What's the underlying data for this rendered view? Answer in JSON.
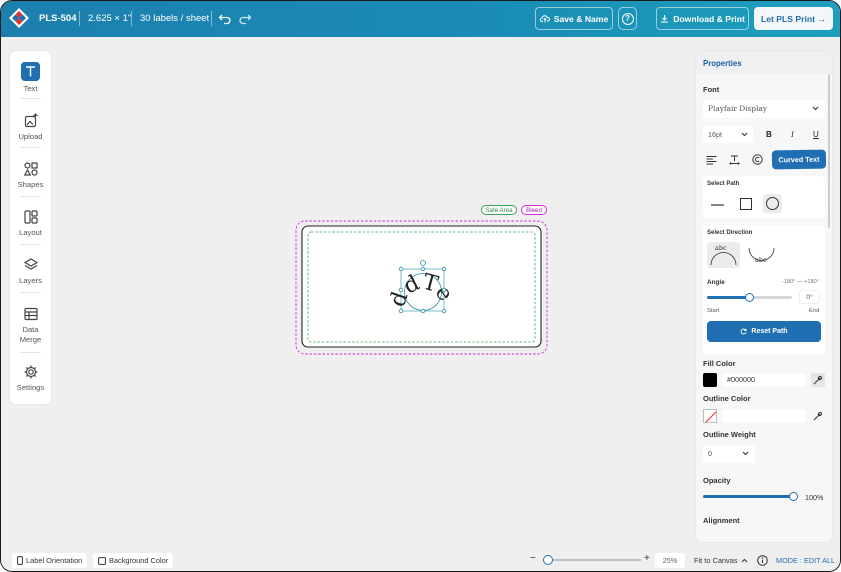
{
  "header": {
    "product_code": "PLS-504",
    "label_size": "2.625 × 1\"",
    "labels_per_sheet": "30 labels / sheet",
    "save_label": "Save & Name",
    "help_label": "?",
    "download_label": "Download & Print",
    "pls_print_label": "Let PLS Print →"
  },
  "toolbar": {
    "items": [
      {
        "label": "Text",
        "icon": "text-icon"
      },
      {
        "label": "Upload",
        "icon": "upload-image-icon"
      },
      {
        "label": "Shapes",
        "icon": "shapes-icon"
      },
      {
        "label": "Layout",
        "icon": "layout-icon"
      },
      {
        "label": "Layers",
        "icon": "layers-icon"
      },
      {
        "label": "Data",
        "label2": "Merge",
        "icon": "table-icon"
      },
      {
        "label": "Settings",
        "icon": "gear-icon"
      }
    ]
  },
  "canvas": {
    "safe_area_label": "Safe Area",
    "bleed_label": "Bleed",
    "curved_text": "AddText",
    "safe_color": "#3aa655",
    "bleed_color": "#d02bd0"
  },
  "properties": {
    "title": "Properties",
    "font_label": "Font",
    "font_value": "Playfair Display",
    "size_value": "16pt",
    "bold": "B",
    "italic": "I",
    "underline": "U",
    "curved_text_label": "Curved Text",
    "select_path_label": "Select Path",
    "select_direction_label": "Select Direction",
    "direction_up_text": "abc",
    "direction_down_text": "abc",
    "angle_label": "Angle",
    "angle_range": "-180° — +180°",
    "angle_value": "0°",
    "angle_level": 0.5,
    "start_label": "Start",
    "end_label": "End",
    "reset_path_label": "Reset Path",
    "fill_color_label": "Fill Color",
    "fill_color_value": "#000000",
    "outline_color_label": "Outline Color",
    "outline_weight_label": "Outline Weight",
    "outline_weight_value": "0",
    "opacity_label": "Opacity",
    "opacity_value": "100%",
    "opacity_level": 1.0,
    "alignment_label": "Alignment"
  },
  "bottom": {
    "label_orientation": "Label Orientation",
    "background_color": "Background Color",
    "zoom_minus": "−",
    "zoom_plus": "+",
    "zoom_value": "25%",
    "zoom_level": 0.05,
    "fit_to_canvas": "Fit to Canvas",
    "mode_label": "MODE : EDIT ALL"
  },
  "colors": {
    "header": "#1d8ab5",
    "accent": "#1f6fb2"
  }
}
